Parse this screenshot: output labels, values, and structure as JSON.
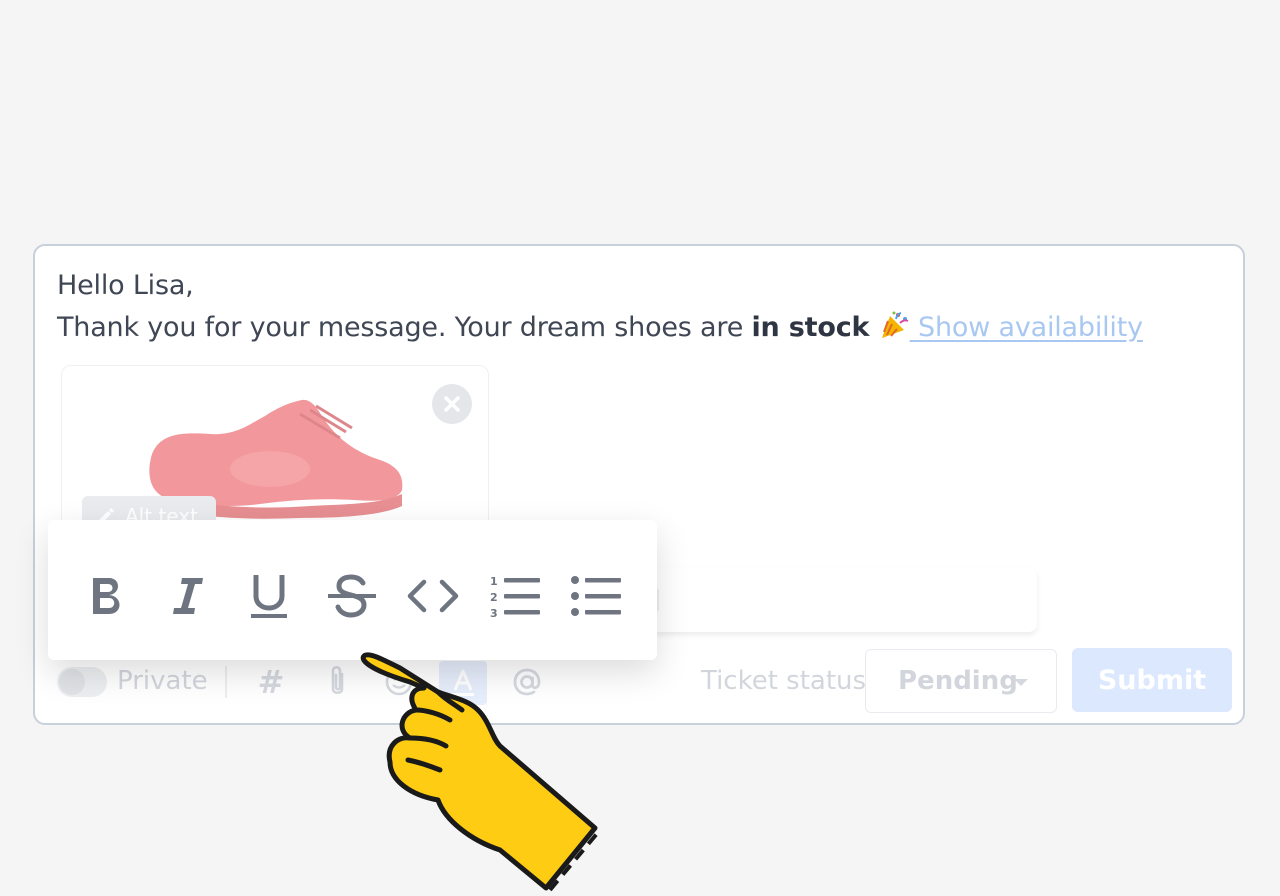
{
  "composer": {
    "greeting": "Hello Lisa,",
    "body_prefix": "Thank you for your message.  Your dream shoes are ",
    "body_bold": "in stock",
    "link_text": " Show availability"
  },
  "attachment": {
    "alt_text_label": "Alt text"
  },
  "format_toolbar": {
    "bold_label": "B",
    "italic_label": "I",
    "underline_label": "U",
    "strike_label": "S"
  },
  "bottom_bar": {
    "private_label": "Private",
    "hash_label": "#",
    "ticket_status_label": "Ticket status",
    "status_value": "Pending",
    "submit_label": "Submit"
  },
  "colors": {
    "accent_link": "#a8c8f2",
    "submit_bg": "#dce8fd",
    "hand_fill": "#fdcc13",
    "shoe": "#e8434a"
  },
  "icons": [
    "party-popper-icon",
    "close-icon",
    "pencil-icon",
    "hash-icon",
    "paperclip-icon",
    "emoji-icon",
    "text-format-icon",
    "at-icon",
    "chevron-down-icon",
    "bold-icon",
    "italic-icon",
    "underline-icon",
    "strikethrough-icon",
    "code-icon",
    "ordered-list-icon",
    "bullet-list-icon",
    "pointing-hand-icon"
  ]
}
